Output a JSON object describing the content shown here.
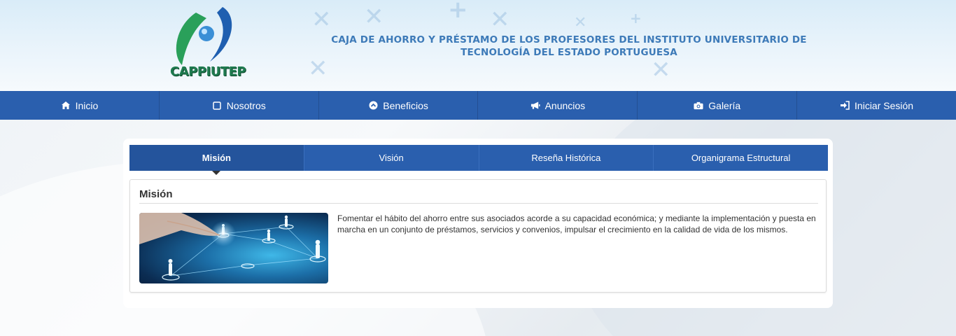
{
  "header": {
    "logo_text": "CAPPIUTEP",
    "title": "CAJA DE AHORRO Y PRÉSTAMO DE LOS PROFESORES DEL INSTITUTO UNIVERSITARIO DE TECNOLOGÍA DEL ESTADO PORTUGUESA"
  },
  "nav": {
    "items": [
      {
        "label": "Inicio",
        "icon": "home-icon"
      },
      {
        "label": "Nosotros",
        "icon": "square-icon"
      },
      {
        "label": "Beneficios",
        "icon": "chevron-circle-up-icon"
      },
      {
        "label": "Anuncios",
        "icon": "megaphone-icon"
      },
      {
        "label": "Galería",
        "icon": "camera-icon"
      },
      {
        "label": "Iniciar Sesión",
        "icon": "sign-in-icon"
      }
    ]
  },
  "tabs": [
    {
      "label": "Misión",
      "active": true
    },
    {
      "label": "Visión",
      "active": false
    },
    {
      "label": "Reseña Histórica",
      "active": false
    },
    {
      "label": "Organigrama Estructural",
      "active": false
    }
  ],
  "panel": {
    "title": "Misión",
    "text": "Fomentar el hábito del ahorro entre sus asociados acorde a su capacidad económica; y mediante la implementación y puesta en marcha en un conjunto de préstamos, servicios y convenios, impulsar el crecimiento en la calidad de vida de los mismos."
  },
  "colors": {
    "nav_bg": "#2a5fae",
    "title_blue": "#3d7ab8",
    "logo_green": "#1f7b4f"
  }
}
